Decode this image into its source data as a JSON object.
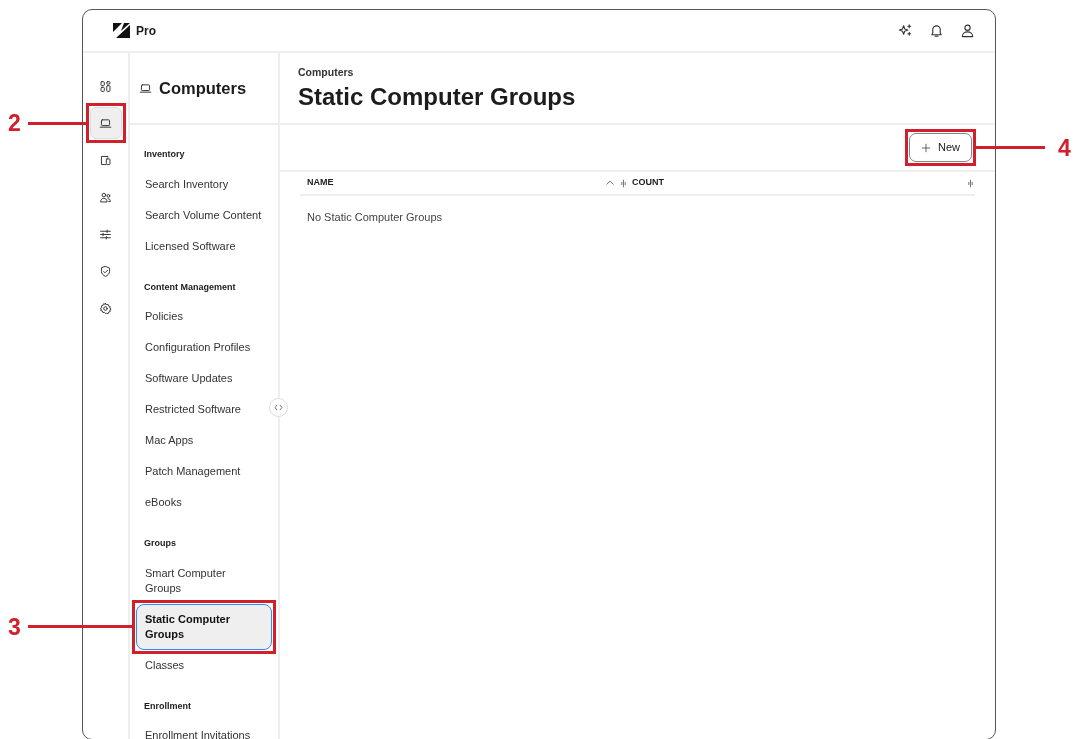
{
  "brand": {
    "product": "Pro"
  },
  "rail": [
    {
      "selected": false
    },
    {
      "selected": true,
      "callout": "2"
    },
    {
      "selected": false
    },
    {
      "selected": false
    },
    {
      "selected": false
    },
    {
      "selected": false
    },
    {
      "selected": false
    }
  ],
  "sidebar": {
    "title": "Computers",
    "sections": [
      {
        "heading": "Inventory",
        "items": [
          {
            "label": "Search Inventory",
            "selected": false
          },
          {
            "label": "Search Volume Content",
            "selected": false
          },
          {
            "label": "Licensed Software",
            "selected": false
          }
        ]
      },
      {
        "heading": "Content Management",
        "items": [
          {
            "label": "Policies",
            "selected": false
          },
          {
            "label": "Configuration Profiles",
            "selected": false
          },
          {
            "label": "Software Updates",
            "selected": false
          },
          {
            "label": "Restricted Software",
            "selected": false
          },
          {
            "label": "Mac Apps",
            "selected": false
          },
          {
            "label": "Patch Management",
            "selected": false
          },
          {
            "label": "eBooks",
            "selected": false
          }
        ]
      },
      {
        "heading": "Groups",
        "items": [
          {
            "label": "Smart Computer Groups",
            "selected": false
          },
          {
            "label": "Static Computer Groups",
            "selected": true,
            "callout": "3"
          },
          {
            "label": "Classes",
            "selected": false
          }
        ]
      },
      {
        "heading": "Enrollment",
        "items": [
          {
            "label": "Enrollment Invitations",
            "selected": false
          }
        ]
      }
    ]
  },
  "main": {
    "breadcrumb": "Computers",
    "title": "Static Computer Groups",
    "new_button": {
      "label": "New",
      "callout": "4"
    },
    "table": {
      "columns": [
        "NAME",
        "COUNT"
      ],
      "empty_text": "No Static Computer Groups"
    }
  }
}
